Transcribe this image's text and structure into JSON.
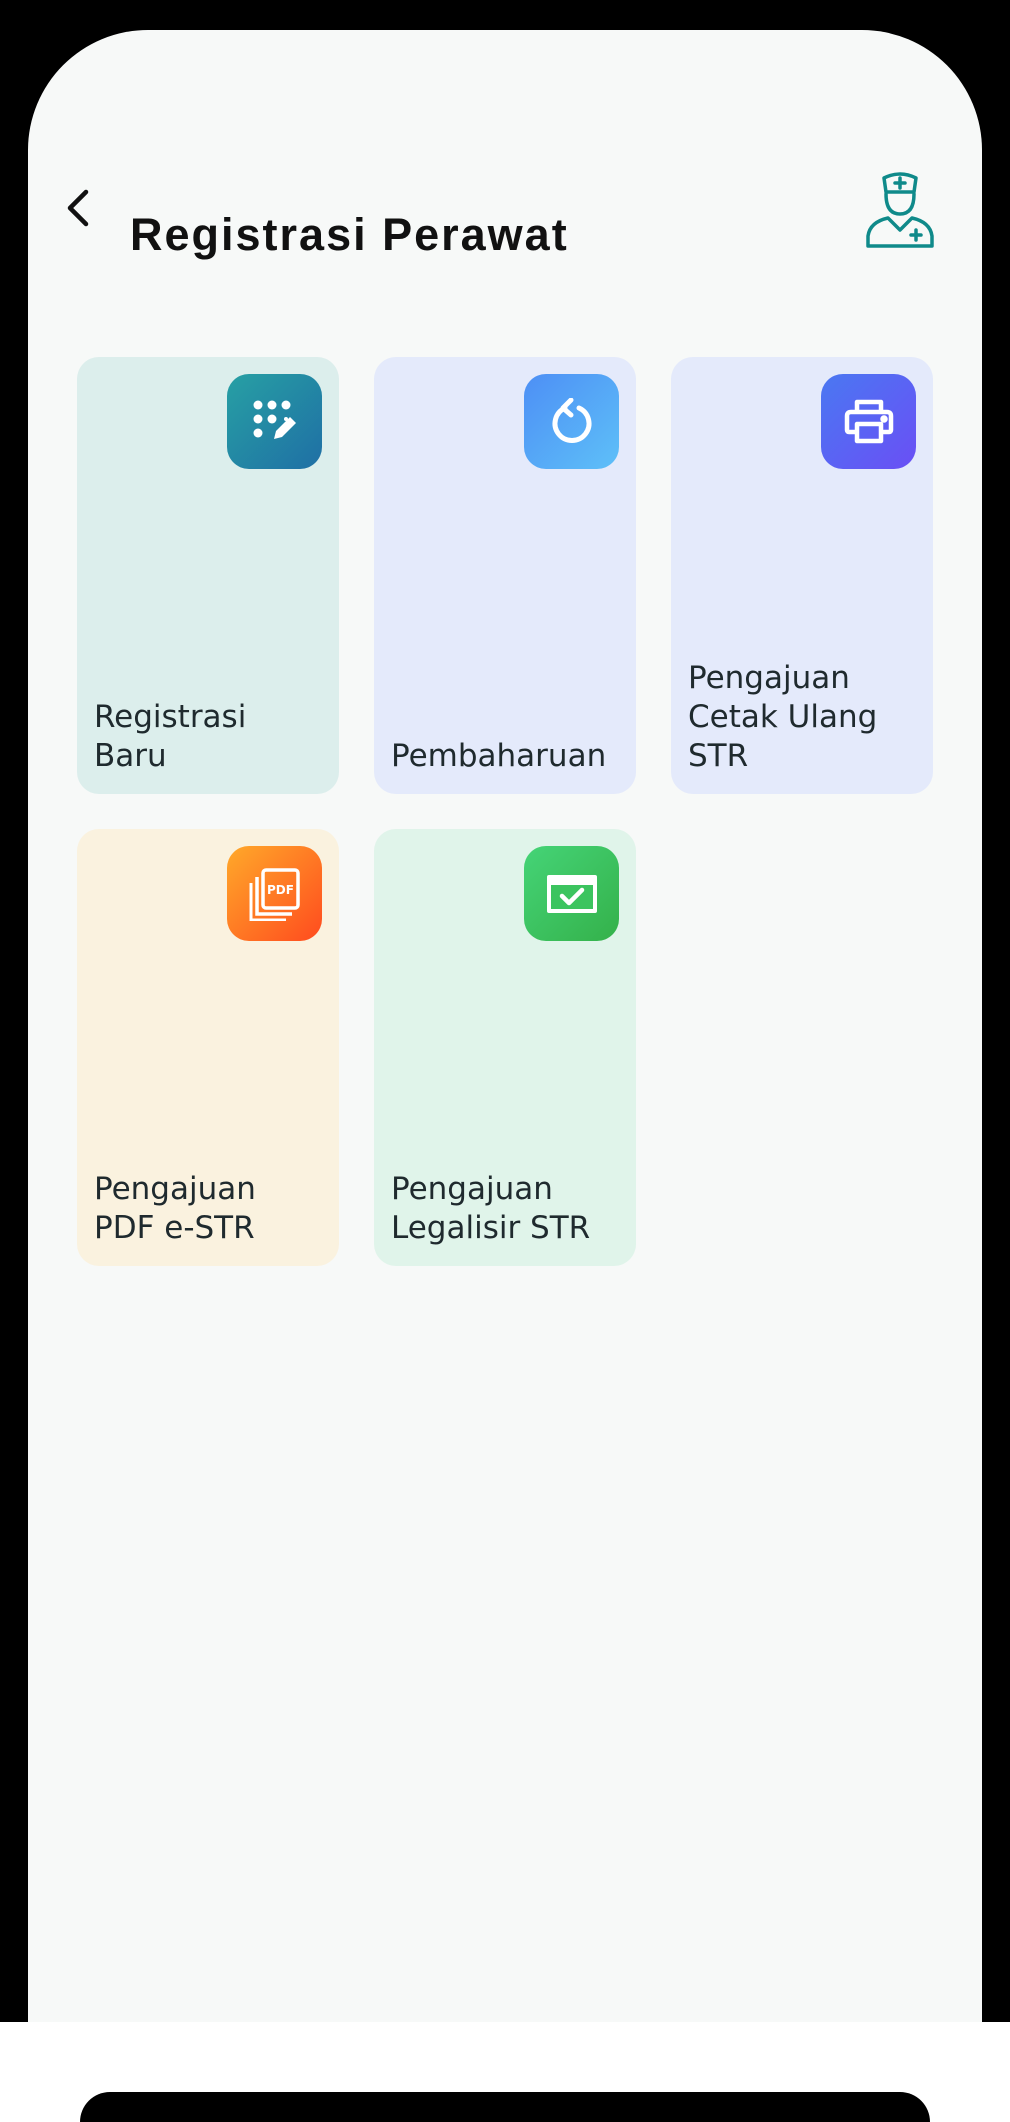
{
  "header": {
    "title": "Registrasi Perawat",
    "back_icon": "chevron-left-icon",
    "profile_icon": "nurse-icon",
    "accent_color": "#0f8a8a"
  },
  "menu": {
    "items": [
      {
        "label": "Registrasi\nBaru",
        "icon": "keypad-edit-icon",
        "tile_color": "#dceeec",
        "icon_gradient": [
          "#27a0a4",
          "#1f6fa5"
        ]
      },
      {
        "label": "Pembaharuan",
        "icon": "refresh-icon",
        "tile_color": "#e4eafb",
        "icon_gradient": [
          "#4d8ff5",
          "#5ec0f8"
        ]
      },
      {
        "label": "Pengajuan\nCetak Ulang\nSTR",
        "icon": "printer-icon",
        "tile_color": "#e4eafb",
        "icon_gradient": [
          "#4a78f2",
          "#6a4ff5"
        ]
      },
      {
        "label": "Pengajuan\nPDF e-STR",
        "icon": "pdf-icon",
        "tile_color": "#faf2df",
        "icon_gradient": [
          "#ffa92a",
          "#ff4b1e"
        ]
      },
      {
        "label": "Pengajuan\nLegalisir STR",
        "icon": "certificate-check-icon",
        "tile_color": "#e0f4ea",
        "icon_gradient": [
          "#45d477",
          "#34b14a"
        ]
      }
    ]
  }
}
